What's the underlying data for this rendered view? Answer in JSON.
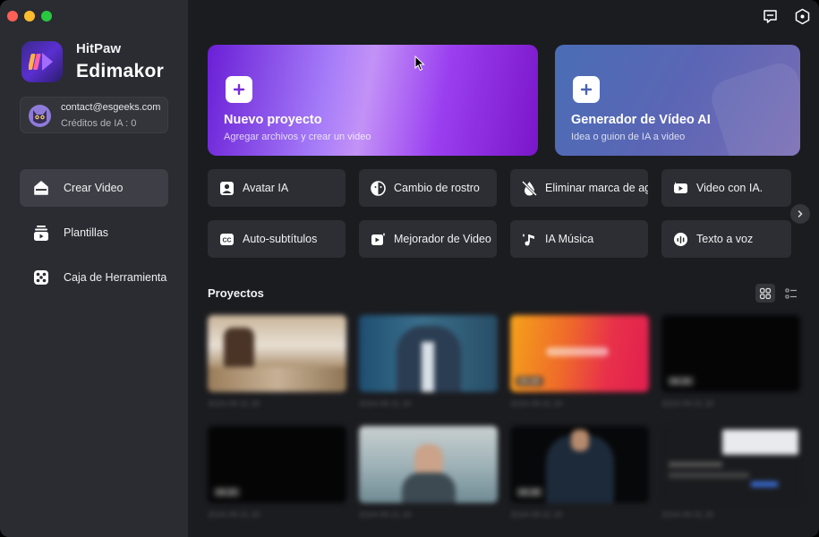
{
  "app": {
    "brand_small": "HitPaw",
    "brand_big": "Edimakor"
  },
  "account": {
    "email": "contact@esgeeks.com",
    "credits": "Créditos de IA : 0"
  },
  "nav": [
    {
      "label": "Crear Video",
      "icon": "home-icon",
      "active": true
    },
    {
      "label": "Plantillas",
      "icon": "templates-icon",
      "active": false
    },
    {
      "label": "Caja de Herramienta",
      "icon": "toolbox-icon",
      "active": false
    }
  ],
  "hero": [
    {
      "title": "Nuevo proyecto",
      "subtitle": "Agregar archivos y crear un video"
    },
    {
      "title": "Generador de Vídeo AI",
      "subtitle": "Idea o guion de IA a video"
    }
  ],
  "tools": [
    {
      "label": "Avatar IA",
      "icon": "avatar-icon"
    },
    {
      "label": "Cambio de rostro",
      "icon": "face-swap-icon"
    },
    {
      "label": "Eliminar marca de agua",
      "icon": "watermark-remove-icon"
    },
    {
      "label": "Video con IA.",
      "icon": "ai-video-icon"
    },
    {
      "label": "Auto-subtítulos",
      "icon": "subtitles-icon"
    },
    {
      "label": "Mejorador de Video",
      "icon": "enhancer-icon"
    },
    {
      "label": "IA Música",
      "icon": "music-icon"
    },
    {
      "label": "Texto a voz",
      "icon": "tts-icon"
    }
  ],
  "projects": {
    "title": "Proyectos",
    "items": [
      {
        "date": "2024-09-21 20",
        "duration": ""
      },
      {
        "date": "2024-09-21 20",
        "duration": ""
      },
      {
        "date": "2024-09-21 20",
        "duration": "00:28"
      },
      {
        "date": "2024-09-21 20",
        "duration": "00:20"
      },
      {
        "date": "2024-09-21 20",
        "duration": "00:20"
      },
      {
        "date": "2024-09-21 20",
        "duration": ""
      },
      {
        "date": "2024-09-21 20",
        "duration": "00:28"
      },
      {
        "date": "2024-09-21 20",
        "duration": ""
      }
    ]
  },
  "colors": {
    "accent_purple": "#8b3ff0",
    "sidebar": "#2b2c31",
    "main": "#1b1c20"
  }
}
